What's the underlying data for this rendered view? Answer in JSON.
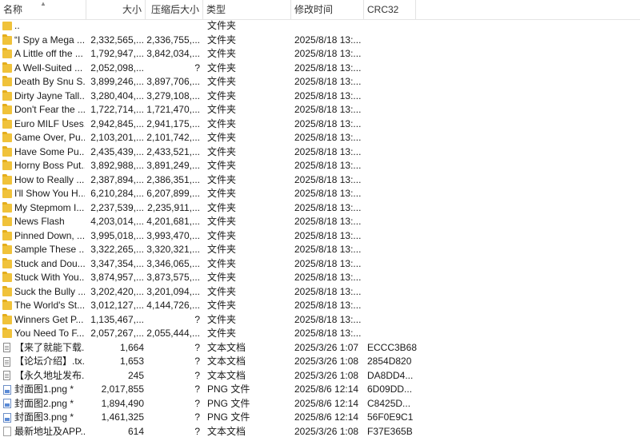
{
  "columns": {
    "name": "名称",
    "size": "大小",
    "packed": "压缩后大小",
    "type": "类型",
    "modified": "修改时间",
    "crc": "CRC32"
  },
  "rows": [
    {
      "icon": "folder-up-icon",
      "name": "..",
      "size": "",
      "packed": "",
      "type": "文件夹",
      "modified": "",
      "crc": ""
    },
    {
      "icon": "folder-icon",
      "name": "“I Spy a Mega ...",
      "size": "2,332,565,...",
      "packed": "2,336,755,...",
      "type": "文件夹",
      "modified": "2025/8/18 13:...",
      "crc": ""
    },
    {
      "icon": "folder-icon",
      "name": "A Little off the ...",
      "size": "1,792,947,...",
      "packed": "3,842,034,...",
      "type": "文件夹",
      "modified": "2025/8/18 13:...",
      "crc": ""
    },
    {
      "icon": "folder-icon",
      "name": "A Well-Suited ...",
      "size": "2,052,098,...",
      "packed": "?",
      "type": "文件夹",
      "modified": "2025/8/18 13:...",
      "crc": ""
    },
    {
      "icon": "folder-icon",
      "name": "Death By Snu S...",
      "size": "3,899,246,...",
      "packed": "3,897,706,...",
      "type": "文件夹",
      "modified": "2025/8/18 13:...",
      "crc": ""
    },
    {
      "icon": "folder-icon",
      "name": "Dirty Jayne Tall...",
      "size": "3,280,404,...",
      "packed": "3,279,108,...",
      "type": "文件夹",
      "modified": "2025/8/18 13:...",
      "crc": ""
    },
    {
      "icon": "folder-icon",
      "name": "Don't Fear the ...",
      "size": "1,722,714,...",
      "packed": "1,721,470,...",
      "type": "文件夹",
      "modified": "2025/8/18 13:...",
      "crc": ""
    },
    {
      "icon": "folder-icon",
      "name": "Euro MILF Uses...",
      "size": "2,942,845,...",
      "packed": "2,941,175,...",
      "type": "文件夹",
      "modified": "2025/8/18 13:...",
      "crc": ""
    },
    {
      "icon": "folder-icon",
      "name": "Game Over, Pu...",
      "size": "2,103,201,...",
      "packed": "2,101,742,...",
      "type": "文件夹",
      "modified": "2025/8/18 13:...",
      "crc": ""
    },
    {
      "icon": "folder-icon",
      "name": "Have Some Pu...",
      "size": "2,435,439,...",
      "packed": "2,433,521,...",
      "type": "文件夹",
      "modified": "2025/8/18 13:...",
      "crc": ""
    },
    {
      "icon": "folder-icon",
      "name": "Horny Boss Put...",
      "size": "3,892,988,...",
      "packed": "3,891,249,...",
      "type": "文件夹",
      "modified": "2025/8/18 13:...",
      "crc": ""
    },
    {
      "icon": "folder-icon",
      "name": "How to Really ...",
      "size": "2,387,894,...",
      "packed": "2,386,351,...",
      "type": "文件夹",
      "modified": "2025/8/18 13:...",
      "crc": ""
    },
    {
      "icon": "folder-icon",
      "name": "I'll Show You H...",
      "size": "6,210,284,...",
      "packed": "6,207,899,...",
      "type": "文件夹",
      "modified": "2025/8/18 13:...",
      "crc": ""
    },
    {
      "icon": "folder-icon",
      "name": "My Stepmom I...",
      "size": "2,237,539,...",
      "packed": "2,235,911,...",
      "type": "文件夹",
      "modified": "2025/8/18 13:...",
      "crc": ""
    },
    {
      "icon": "folder-icon",
      "name": "News Flash",
      "size": "4,203,014,...",
      "packed": "4,201,681,...",
      "type": "文件夹",
      "modified": "2025/8/18 13:...",
      "crc": ""
    },
    {
      "icon": "folder-icon",
      "name": "Pinned Down, ...",
      "size": "3,995,018,...",
      "packed": "3,993,470,...",
      "type": "文件夹",
      "modified": "2025/8/18 13:...",
      "crc": ""
    },
    {
      "icon": "folder-icon",
      "name": "Sample These ...",
      "size": "3,322,265,...",
      "packed": "3,320,321,...",
      "type": "文件夹",
      "modified": "2025/8/18 13:...",
      "crc": ""
    },
    {
      "icon": "folder-icon",
      "name": "Stuck and Dou...",
      "size": "3,347,354,...",
      "packed": "3,346,065,...",
      "type": "文件夹",
      "modified": "2025/8/18 13:...",
      "crc": ""
    },
    {
      "icon": "folder-icon",
      "name": "Stuck With You...",
      "size": "3,874,957,...",
      "packed": "3,873,575,...",
      "type": "文件夹",
      "modified": "2025/8/18 13:...",
      "crc": ""
    },
    {
      "icon": "folder-icon",
      "name": "Suck the Bully ...",
      "size": "3,202,420,...",
      "packed": "3,201,094,...",
      "type": "文件夹",
      "modified": "2025/8/18 13:...",
      "crc": ""
    },
    {
      "icon": "folder-icon",
      "name": "The World's St...",
      "size": "3,012,127,...",
      "packed": "4,144,726,...",
      "type": "文件夹",
      "modified": "2025/8/18 13:...",
      "crc": ""
    },
    {
      "icon": "folder-icon",
      "name": "Winners Get P...",
      "size": "1,135,467,...",
      "packed": "?",
      "type": "文件夹",
      "modified": "2025/8/18 13:...",
      "crc": ""
    },
    {
      "icon": "folder-icon",
      "name": "You Need To F...",
      "size": "2,057,267,...",
      "packed": "2,055,444,...",
      "type": "文件夹",
      "modified": "2025/8/18 13:...",
      "crc": ""
    },
    {
      "icon": "text-file-icon",
      "name": "【来了就能下载...",
      "size": "1,664",
      "packed": "?",
      "type": "文本文档",
      "modified": "2025/3/26 1:07",
      "crc": "ECCC3B68"
    },
    {
      "icon": "text-file-icon",
      "name": "【论坛介绍】.tx...",
      "size": "1,653",
      "packed": "?",
      "type": "文本文档",
      "modified": "2025/3/26 1:08",
      "crc": "2854D820"
    },
    {
      "icon": "text-file-icon",
      "name": "【永久地址发布...",
      "size": "245",
      "packed": "?",
      "type": "文本文档",
      "modified": "2025/3/26 1:08",
      "crc": "DA8DD4..."
    },
    {
      "icon": "png-file-icon",
      "name": "封面图1.png *",
      "size": "2,017,855",
      "packed": "?",
      "type": "PNG 文件",
      "modified": "2025/8/6 12:14",
      "crc": "6D09DD..."
    },
    {
      "icon": "png-file-icon",
      "name": "封面图2.png *",
      "size": "1,894,490",
      "packed": "?",
      "type": "PNG 文件",
      "modified": "2025/8/6 12:14",
      "crc": "C8425D..."
    },
    {
      "icon": "png-file-icon",
      "name": "封面图3.png *",
      "size": "1,461,325",
      "packed": "?",
      "type": "PNG 文件",
      "modified": "2025/8/6 12:14",
      "crc": "56F0E9C1"
    },
    {
      "icon": "blank-file-icon",
      "name": "最新地址及APP...",
      "size": "614",
      "packed": "?",
      "type": "文本文档",
      "modified": "2025/3/26 1:08",
      "crc": "F37E365B"
    }
  ]
}
